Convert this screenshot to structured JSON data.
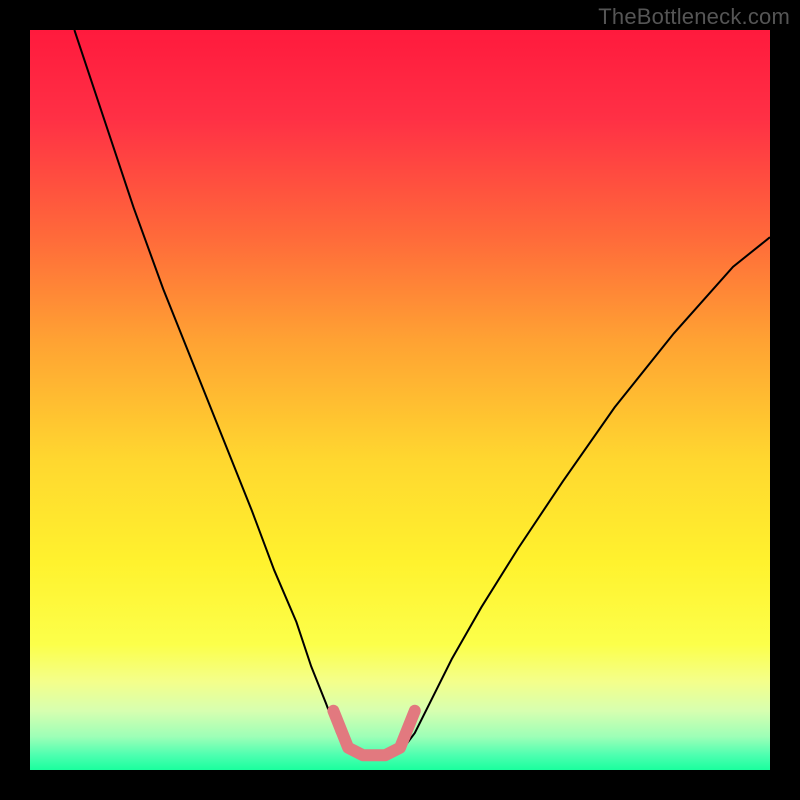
{
  "watermark": "TheBottleneck.com",
  "chart_data": {
    "type": "line",
    "title": "",
    "xlabel": "",
    "ylabel": "",
    "xlim": [
      0,
      100
    ],
    "ylim": [
      0,
      100
    ],
    "background_gradient": {
      "stops": [
        {
          "offset": 0.0,
          "color": "#ff1a3d"
        },
        {
          "offset": 0.12,
          "color": "#ff3045"
        },
        {
          "offset": 0.28,
          "color": "#ff6a3a"
        },
        {
          "offset": 0.42,
          "color": "#ffa233"
        },
        {
          "offset": 0.58,
          "color": "#ffd72f"
        },
        {
          "offset": 0.72,
          "color": "#fff22e"
        },
        {
          "offset": 0.83,
          "color": "#fcff4a"
        },
        {
          "offset": 0.88,
          "color": "#f4ff8a"
        },
        {
          "offset": 0.92,
          "color": "#d7ffb0"
        },
        {
          "offset": 0.955,
          "color": "#9dffb7"
        },
        {
          "offset": 0.98,
          "color": "#4dffb0"
        },
        {
          "offset": 1.0,
          "color": "#1aff9e"
        }
      ]
    },
    "series": [
      {
        "name": "bottleneck-left",
        "color": "#000000",
        "width": 2,
        "x": [
          6,
          10,
          14,
          18,
          22,
          26,
          30,
          33,
          36,
          38,
          40,
          41.5,
          42.5
        ],
        "y": [
          100,
          88,
          76,
          65,
          55,
          45,
          35,
          27,
          20,
          14,
          9,
          5,
          3
        ]
      },
      {
        "name": "bottleneck-right",
        "color": "#000000",
        "width": 2,
        "x": [
          50.5,
          52,
          54,
          57,
          61,
          66,
          72,
          79,
          87,
          95,
          100
        ],
        "y": [
          3,
          5,
          9,
          15,
          22,
          30,
          39,
          49,
          59,
          68,
          72
        ]
      },
      {
        "name": "optimal-marker",
        "color": "#e2797f",
        "width": 12,
        "linecap": "round",
        "x": [
          41,
          43,
          45,
          48,
          50,
          52
        ],
        "y": [
          8,
          3,
          2,
          2,
          3,
          8
        ]
      }
    ]
  }
}
